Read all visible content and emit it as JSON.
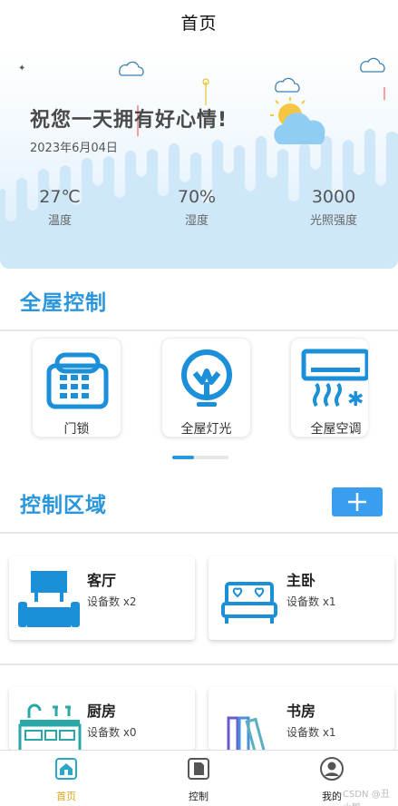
{
  "header": {
    "title": "首页"
  },
  "weather": {
    "greeting": "祝您一天拥有好心情!",
    "date": "2023年6月04日",
    "stats": [
      {
        "value": "27℃",
        "label": "温度"
      },
      {
        "value": "70%",
        "label": "湿度"
      },
      {
        "value": "3000",
        "label": "光照强度"
      }
    ]
  },
  "whole_house": {
    "title": "全屋控制",
    "devices": [
      {
        "label": "门锁",
        "icon": "door-lock-icon"
      },
      {
        "label": "全屋灯光",
        "icon": "light-bulb-icon"
      },
      {
        "label": "全屋空调",
        "icon": "air-conditioner-icon"
      }
    ],
    "scroll_progress": 0.39
  },
  "areas": {
    "title": "控制区域",
    "add_icon": "plus-icon",
    "rooms": [
      {
        "name": "客厅",
        "count": "设备数 x2",
        "icon": "sofa-icon"
      },
      {
        "name": "主卧",
        "count": "设备数 x1",
        "icon": "bed-icon"
      },
      {
        "name": "厨房",
        "count": "设备数 x0",
        "icon": "kitchen-icon"
      },
      {
        "name": "书房",
        "count": "设备数 x1",
        "icon": "books-icon"
      }
    ]
  },
  "tabbar": {
    "tabs": [
      {
        "label": "首页",
        "icon": "home-icon",
        "active": true
      },
      {
        "label": "控制",
        "icon": "document-icon",
        "active": false
      },
      {
        "label": "我的",
        "icon": "user-icon",
        "active": false
      }
    ]
  },
  "watermark": "CSDN @丑小鸭",
  "colors": {
    "accent": "#2a96dc",
    "button": "#3a9ef0",
    "active_tab": "#e0a41a",
    "icon_blue": "#1b8fd8"
  }
}
